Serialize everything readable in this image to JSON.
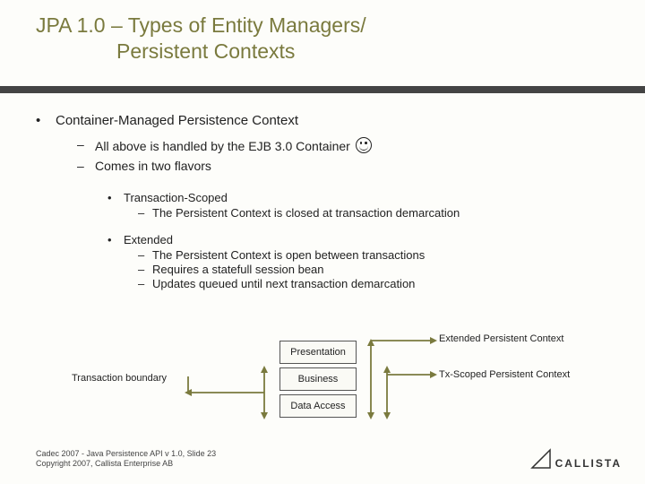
{
  "title": {
    "line1": "JPA 1.0 – Types of Entity Managers/",
    "line2": "Persistent Contexts"
  },
  "bullets": {
    "main": "Container-Managed Persistence Context",
    "sub1": "All above is handled by the EJB 3.0 Container",
    "sub2": "Comes in two flavors",
    "txscoped": {
      "head": "Transaction-Scoped",
      "p1": "The Persistent Context is closed at transaction demarcation"
    },
    "extended": {
      "head": "Extended",
      "p1": "The Persistent Context is open between transactions",
      "p2": "Requires a statefull session bean",
      "p3": "Updates queued until next transaction demarcation"
    }
  },
  "diagram": {
    "transaction_boundary": "Transaction boundary",
    "boxes": {
      "presentation": "Presentation",
      "business": "Business",
      "data_access": "Data Access"
    },
    "extended_ctx": "Extended Persistent Context",
    "tx_scoped_ctx": "Tx-Scoped Persistent Context"
  },
  "footer": {
    "l1": "Cadec 2007 - Java Persistence API v 1.0, Slide 23",
    "l2": "Copyright 2007, Callista Enterprise AB"
  },
  "brand": "CALLISTA"
}
